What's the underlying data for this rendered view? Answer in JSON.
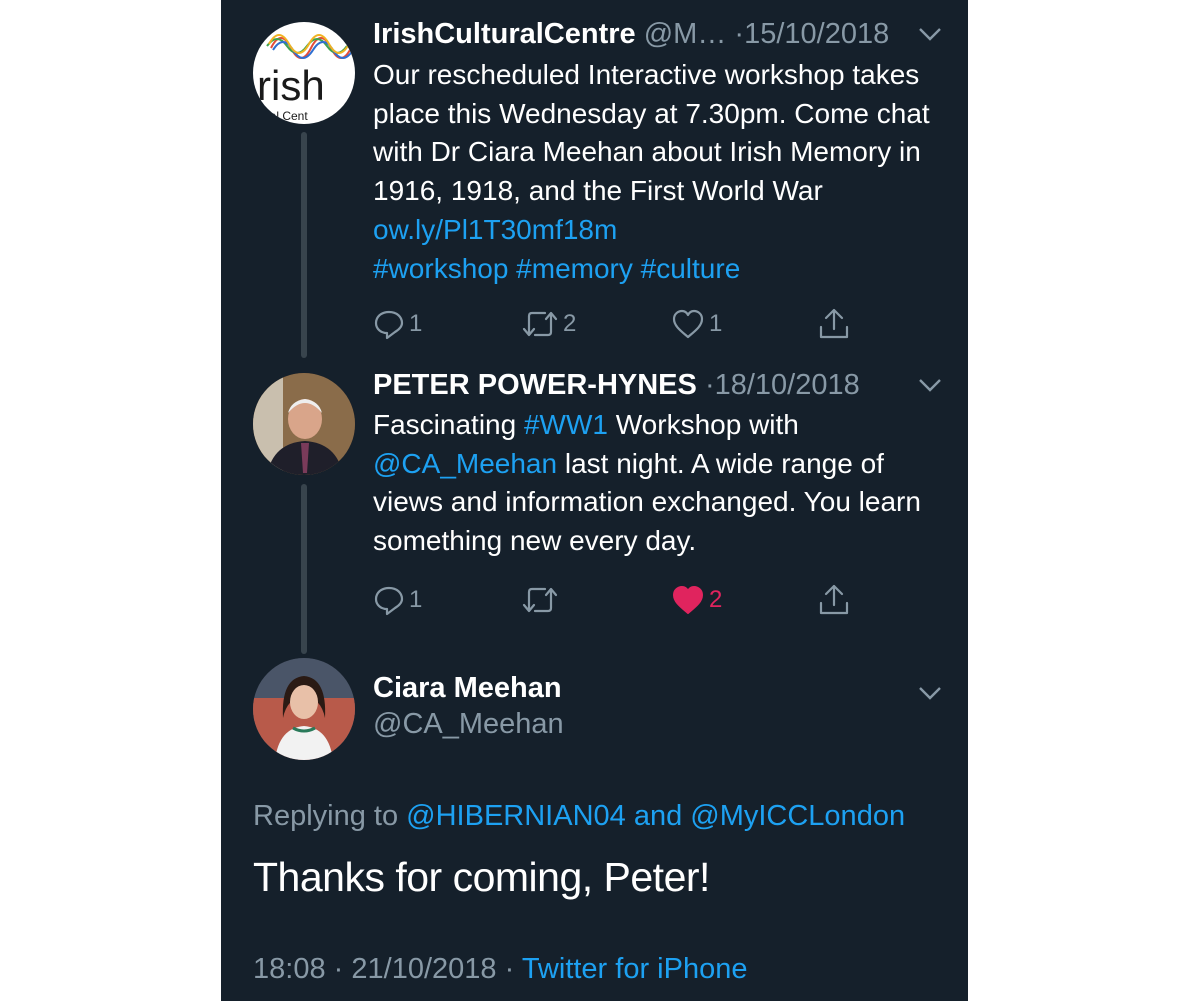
{
  "tweets": [
    {
      "name": "IrishCulturalCentre",
      "handle": "@M…",
      "dot": "·",
      "date": "15/10/2018",
      "avatar_text": "rish",
      "avatar_sub": "ltural Cent",
      "text": {
        "t1": "Our rescheduled Interactive workshop takes place this Wednesday at 7.30pm. Come chat with Dr Ciara Meehan about Irish Memory in 1916, 1918, and the First World War ",
        "link": "ow.ly/Pl1T30mf18m",
        "tags": "#workshop #memory #culture"
      },
      "replies": "1",
      "retweets": "2",
      "likes": "1"
    },
    {
      "name": "PETER POWER-HYNES",
      "dot": "·",
      "date": "18/10/2018",
      "text": {
        "t1": "Fascinating ",
        "tag": "#WW1",
        "t2": " Workshop with ",
        "mention": "@CA_Meehan",
        "t3": " last night. A wide range of views and information exchanged. You learn something new every day."
      },
      "replies": "1",
      "retweets": "",
      "likes": "2"
    }
  ],
  "main": {
    "name": "Ciara Meehan",
    "handle": "@CA_Meehan",
    "replying_prefix": "Replying to ",
    "replying_users": "@HIBERNIAN04 and @MyICCLondon",
    "text": "Thanks for coming, Peter!",
    "time": "18:08",
    "sep": "·",
    "date": "21/10/2018",
    "client": "Twitter for iPhone"
  },
  "colors": {
    "background": "#15202b",
    "accent": "#1da1f2",
    "muted": "#8899a6",
    "like": "#e0245e"
  }
}
